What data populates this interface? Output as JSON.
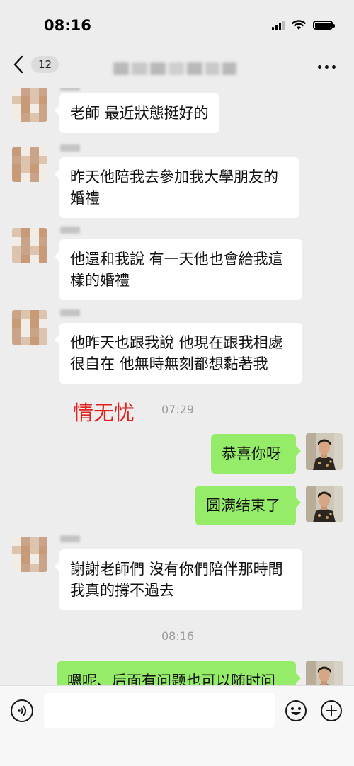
{
  "status_bar": {
    "time": "08:16",
    "icons": [
      "signal-icon",
      "wifi-icon",
      "battery-icon"
    ]
  },
  "nav": {
    "unread_count": "12",
    "icons": [
      "chevron-left-icon",
      "more-icon"
    ]
  },
  "messages": [
    {
      "sender": "contact",
      "text": "老師 最近狀態挺好的"
    },
    {
      "sender": "contact",
      "text_line1": "昨天他陪我去參加我大學朋友的",
      "text_line2": "婚禮"
    },
    {
      "sender": "contact",
      "text_line1": "他還和我說 有一天他也會給我這",
      "text_line2": "樣的婚禮"
    },
    {
      "sender": "contact",
      "text_line1": "他昨天也跟我說 他現在跟我相處",
      "text_line2": "很自在 他無時無刻都想黏著我"
    },
    {
      "type": "time",
      "time": "07:29",
      "overlay": "情无忧"
    },
    {
      "sender": "self",
      "text": "恭喜你呀"
    },
    {
      "sender": "self",
      "text": "圆满结束了"
    },
    {
      "sender": "contact",
      "text_line1": "謝謝老師們 沒有你們陪伴那時間",
      "text_line2": "我真的撐不過去"
    },
    {
      "type": "time",
      "time": "08:16"
    },
    {
      "sender": "self",
      "text": "嗯呢、后面有问题也可以随时问"
    }
  ],
  "input_bar": {
    "placeholder": "",
    "icons": [
      "voice-icon",
      "emoji-icon",
      "plus-icon"
    ]
  },
  "colors": {
    "background": "#ededed",
    "self_bubble": "#95ec69",
    "contact_bubble": "#ffffff",
    "overlay_text": "#e0221e",
    "timestamp": "#9a9a9a"
  }
}
